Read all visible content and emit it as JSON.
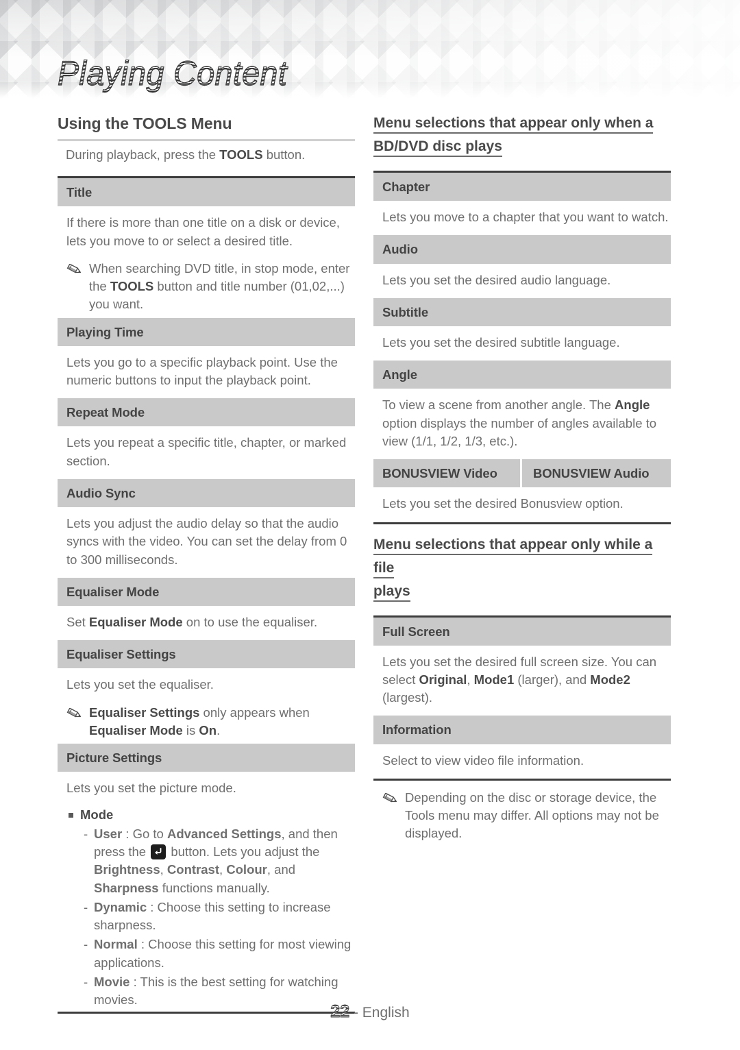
{
  "banner": {
    "title": "Playing Content"
  },
  "left_column": {
    "heading": "Using the TOOLS Menu",
    "lead": "During playback, press the TOOLS button.",
    "rows": [
      {
        "head": "Title",
        "body": "If there is more than one title on a disk or device, lets you move to or select a desired title.",
        "note_pre": "When searching DVD title, in stop mode, enter the ",
        "note_bold": "TOOLS",
        "note_post": " button and title number (01,02,...) you want."
      },
      {
        "head": "Playing Time",
        "body": "Lets you go to a specific playback point. Use the numeric buttons to input the playback point."
      },
      {
        "head": "Repeat Mode",
        "body": "Lets you repeat a specific title, chapter, or marked section."
      },
      {
        "head": "Audio Sync",
        "body": "Lets you adjust the audio delay so that the audio syncs with the video. You can set the delay from 0 to 300 milliseconds."
      },
      {
        "head": "Equaliser Mode",
        "body_pre": "Set ",
        "body_bold": "Equaliser Mode",
        "body_post": " on to use the equaliser."
      },
      {
        "head": "Equaliser Settings",
        "body": "Lets you set the equaliser.",
        "note_b1": "Equaliser Settings",
        "note_mid": " only appears when ",
        "note_b2": "Equaliser Mode",
        "note_mid2": " is ",
        "note_b3": "On",
        "note_end": "."
      },
      {
        "head": "Picture Settings",
        "body": "Lets you set the picture mode.",
        "bullet_title": "Mode",
        "sub_items": [
          {
            "label": "User",
            "sep": " : ",
            "text_pre": "Go to ",
            "bold1": "Advanced Settings",
            "text_mid": ", and then press the ",
            "icon": "enter-button-icon",
            "text_mid2": " button. Lets you adjust the ",
            "bold2": "Brightness",
            "c1": ", ",
            "bold3": "Contrast",
            "c2": ", ",
            "bold4": "Colour",
            "c3": ", and ",
            "bold5": "Sharpness",
            "text_end": " functions manually."
          },
          {
            "label": "Dynamic",
            "sep": " : ",
            "text": "Choose this setting to increase sharpness."
          },
          {
            "label": "Normal",
            "sep": " : ",
            "text": "Choose this setting for most viewing applications."
          },
          {
            "label": "Movie",
            "sep": " : ",
            "text": "This is the best setting for watching movies."
          }
        ]
      }
    ]
  },
  "right_column": {
    "heading_1_line1": "Menu selections that appear only when a",
    "heading_1_line2": "BD/DVD disc plays",
    "rows_1": [
      {
        "head": "Chapter",
        "body": "Lets you move to a chapter that you want to watch."
      },
      {
        "head": "Audio",
        "body": "Lets you set the desired audio language."
      },
      {
        "head": "Subtitle",
        "body": "Lets you set the desired subtitle language."
      },
      {
        "head": "Angle",
        "body_pre": "To view a scene from another angle. The ",
        "body_bold": "Angle",
        "body_post": " option displays the number of angles available to view (1/1, 1/2, 1/3, etc.)."
      }
    ],
    "bonusview": {
      "head_left": "BONUSVIEW Video",
      "head_right": "BONUSVIEW Audio",
      "body": "Lets you set the desired Bonusview option."
    },
    "heading_2_line1": "Menu selections that appear only while a file",
    "heading_2_line2": "plays",
    "rows_2": [
      {
        "head": "Full Screen",
        "body_pre": "Lets you set the desired full screen size. You can select ",
        "b1": "Original",
        "c1": ", ",
        "b2": "Mode1",
        "t1": " (larger), and ",
        "b3": "Mode2",
        "t2": " (largest)."
      },
      {
        "head": "Information",
        "body": "Select to view video file information."
      }
    ],
    "final_note": "Depending on the disc or storage device, the Tools menu may differ. All options may not be displayed."
  },
  "footer": {
    "page_number": "22",
    "language": "- English"
  }
}
